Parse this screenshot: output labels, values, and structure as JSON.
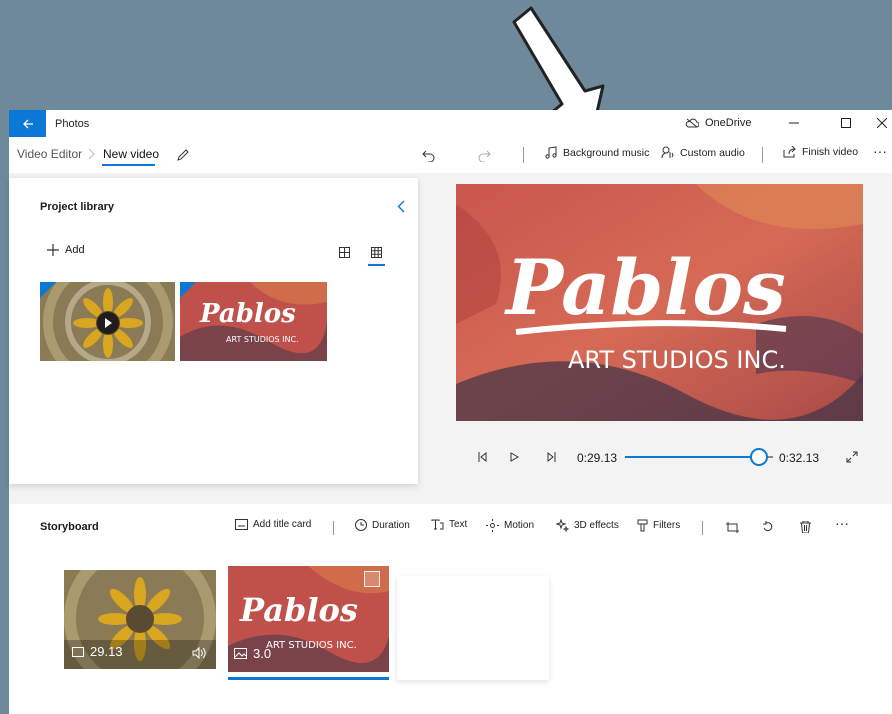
{
  "window": {
    "app_title": "Photos",
    "onedrive_label": "OneDrive",
    "icons": [
      "back-arrow-icon",
      "cloud-icon",
      "minimize-icon",
      "maximize-icon",
      "close-icon"
    ]
  },
  "toolbar": {
    "breadcrumb_root": "Video Editor",
    "breadcrumb_current": "New video",
    "background_music": "Background music",
    "custom_audio": "Custom audio",
    "finish_video": "Finish video",
    "more": "···"
  },
  "library": {
    "title": "Project library",
    "add_label": "Add"
  },
  "player": {
    "current_time": "0:29.13",
    "total_time": "0:32.13",
    "progress": 0.906
  },
  "preview_logo": {
    "brand": "Pablos",
    "subtitle": "ART STUDIOS INC."
  },
  "storyboard": {
    "title": "Storyboard",
    "add_title_card": "Add title card",
    "duration": "Duration",
    "text": "Text",
    "motion": "Motion",
    "effects_3d": "3D effects",
    "filters": "Filters",
    "more": "···",
    "clips": [
      {
        "duration": "29.13",
        "kind": "video"
      },
      {
        "duration": "3.0",
        "kind": "image"
      }
    ]
  },
  "colors": {
    "accent": "#0a78d4",
    "desktop": "#6e8a9a",
    "panel_bg": "#f3f3f3"
  }
}
